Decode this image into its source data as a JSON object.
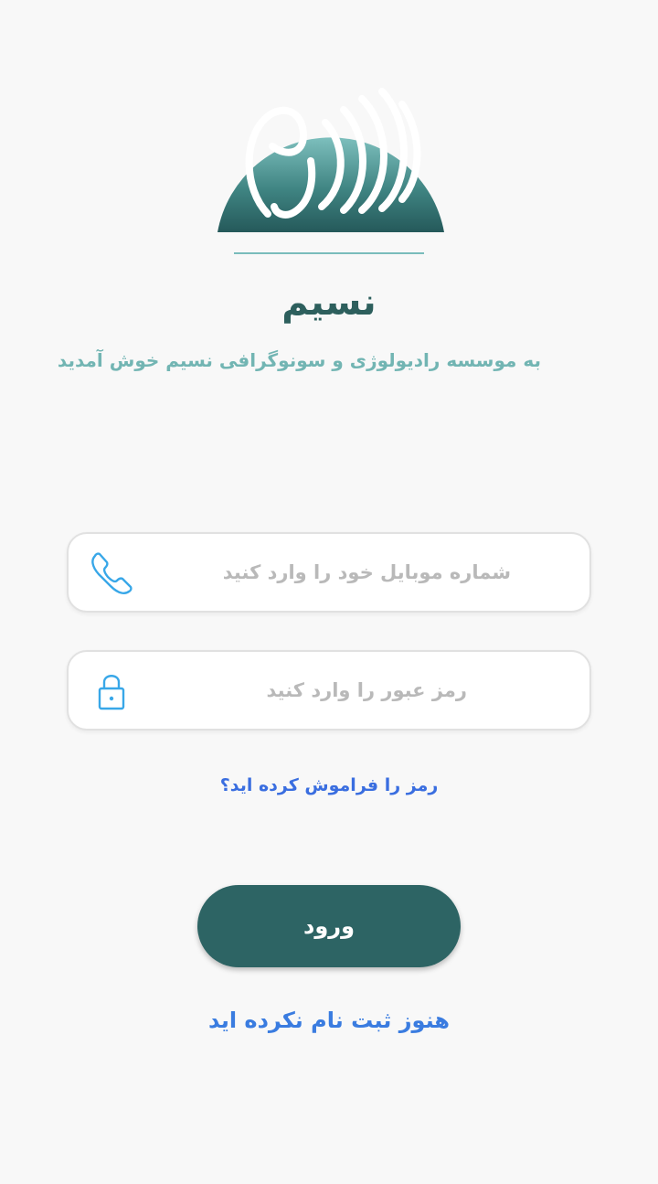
{
  "logo": {
    "icon": "nasim-logo",
    "gradient_top": "#79bcbb",
    "gradient_bottom": "#2d6464"
  },
  "header": {
    "title": "نسیم",
    "subtitle": "به موسسه رادیولوژی و سونوگرافی نسیم خوش آمدید"
  },
  "form": {
    "phone": {
      "placeholder": "شماره موبایل خود را وارد کنید",
      "value": "",
      "icon": "phone-icon"
    },
    "password": {
      "placeholder": "رمز عبور را وارد کنید",
      "value": "",
      "icon": "lock-icon"
    },
    "forgot_label": "رمز را فراموش کرده اید؟",
    "login_label": "ورود",
    "register_label": "هنوز ثبت نام نکرده اید"
  },
  "colors": {
    "primary": "#2d6464",
    "accent": "#72b5b3",
    "link": "#3a6ee0",
    "icon": "#38a7e8",
    "background": "#f8f8f8"
  }
}
